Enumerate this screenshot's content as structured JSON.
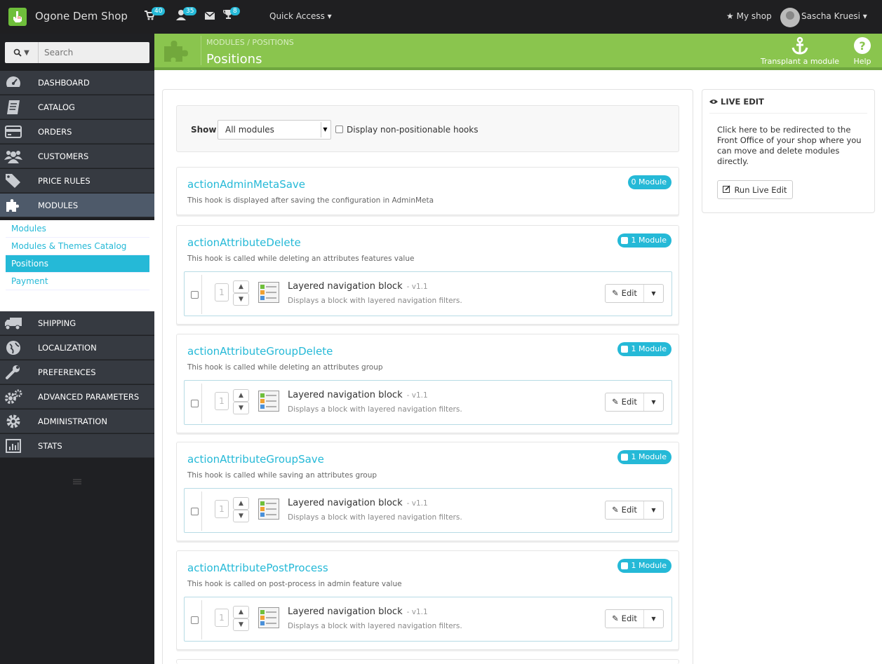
{
  "topbar": {
    "brand": "Ogone Dem Shop",
    "notifications": {
      "orders": "40",
      "customers": "35",
      "messages": "",
      "trophy": "8"
    },
    "quick_access": "Quick Access ▾",
    "my_shop": "My shop",
    "user_name": "Sascha Kruesi ▾"
  },
  "sidebar": {
    "search_placeholder": "Search",
    "items": [
      {
        "label": "DASHBOARD",
        "icon": "dashboard-icon"
      },
      {
        "label": "CATALOG",
        "icon": "catalog-icon"
      },
      {
        "label": "ORDERS",
        "icon": "orders-icon"
      },
      {
        "label": "CUSTOMERS",
        "icon": "customers-icon"
      },
      {
        "label": "PRICE RULES",
        "icon": "tag-icon"
      },
      {
        "label": "MODULES",
        "icon": "puzzle-icon"
      },
      {
        "label": "SHIPPING",
        "icon": "truck-icon"
      },
      {
        "label": "LOCALIZATION",
        "icon": "globe-icon"
      },
      {
        "label": "PREFERENCES",
        "icon": "wrench-icon"
      },
      {
        "label": "ADVANCED PARAMETERS",
        "icon": "cogs-icon"
      },
      {
        "label": "ADMINISTRATION",
        "icon": "cog-icon"
      },
      {
        "label": "STATS",
        "icon": "stats-icon"
      }
    ],
    "submenu": [
      "Modules",
      "Modules & Themes Catalog",
      "Positions",
      "Payment"
    ]
  },
  "header": {
    "breadcrumb": "MODULES / POSITIONS",
    "title": "Positions",
    "transplant_label": "Transplant a module",
    "help_label": "Help"
  },
  "filter": {
    "show_label": "Show",
    "select_value": "All modules",
    "checkbox_label": "Display non-positionable hooks"
  },
  "hooks": [
    {
      "name": "actionAdminMetaSave",
      "desc": "This hook is displayed after saving the configuration in AdminMeta",
      "badge": "0 Module",
      "modules": []
    },
    {
      "name": "actionAttributeDelete",
      "desc": "This hook is called while deleting an attributes features value",
      "badge": "1 Module",
      "modules": [
        {
          "position": "1",
          "name": "Layered navigation block",
          "version": "- v1.1",
          "desc": "Displays a block with layered navigation filters.",
          "edit": "Edit"
        }
      ]
    },
    {
      "name": "actionAttributeGroupDelete",
      "desc": "This hook is called while deleting an attributes group",
      "badge": "1 Module",
      "modules": [
        {
          "position": "1",
          "name": "Layered navigation block",
          "version": "- v1.1",
          "desc": "Displays a block with layered navigation filters.",
          "edit": "Edit"
        }
      ]
    },
    {
      "name": "actionAttributeGroupSave",
      "desc": "This hook is called while saving an attributes group",
      "badge": "1 Module",
      "modules": [
        {
          "position": "1",
          "name": "Layered navigation block",
          "version": "- v1.1",
          "desc": "Displays a block with layered navigation filters.",
          "edit": "Edit"
        }
      ]
    },
    {
      "name": "actionAttributePostProcess",
      "desc": "This hook is called on post-process in admin feature value",
      "badge": "1 Module",
      "modules": [
        {
          "position": "1",
          "name": "Layered navigation block",
          "version": "- v1.1",
          "desc": "Displays a block with layered navigation filters.",
          "edit": "Edit"
        }
      ]
    }
  ],
  "live_edit": {
    "title": "LIVE EDIT",
    "text": "Click here to be redirected to the Front Office of your shop where you can move and delete modules directly.",
    "button": "Run Live Edit"
  },
  "colors": {
    "accent": "#25b9d7",
    "header_green": "#8ac54e",
    "sidebar_dark": "#363a41"
  }
}
